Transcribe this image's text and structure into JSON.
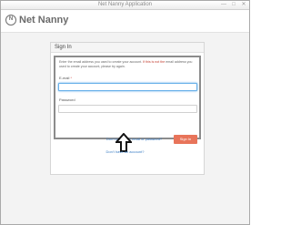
{
  "window": {
    "title": "Net Nanny Application",
    "controls": [
      "—",
      "□",
      "✕"
    ]
  },
  "app": {
    "logo_glyph": "N",
    "name": "Net Nanny"
  },
  "panel": {
    "title": "Sign In",
    "instructions_line1": "Enter the email address you used to create your account. ",
    "instructions_warning": "If this is not the",
    "instructions_line2": "email address you used to create your account, please try again.",
    "email_label": "E-mail",
    "email_required": "*",
    "email_value": "",
    "password_label": "Password",
    "password_value": "",
    "forgot_link": "Don't know your email or password?",
    "signin_button": "Sign In"
  },
  "footer": {
    "arrow_icon": "up-arrow-icon",
    "link": "Don't have an account?"
  },
  "colors": {
    "accent_button": "#e8745a",
    "link": "#3b7dc4",
    "focus_border": "#66afe9"
  }
}
